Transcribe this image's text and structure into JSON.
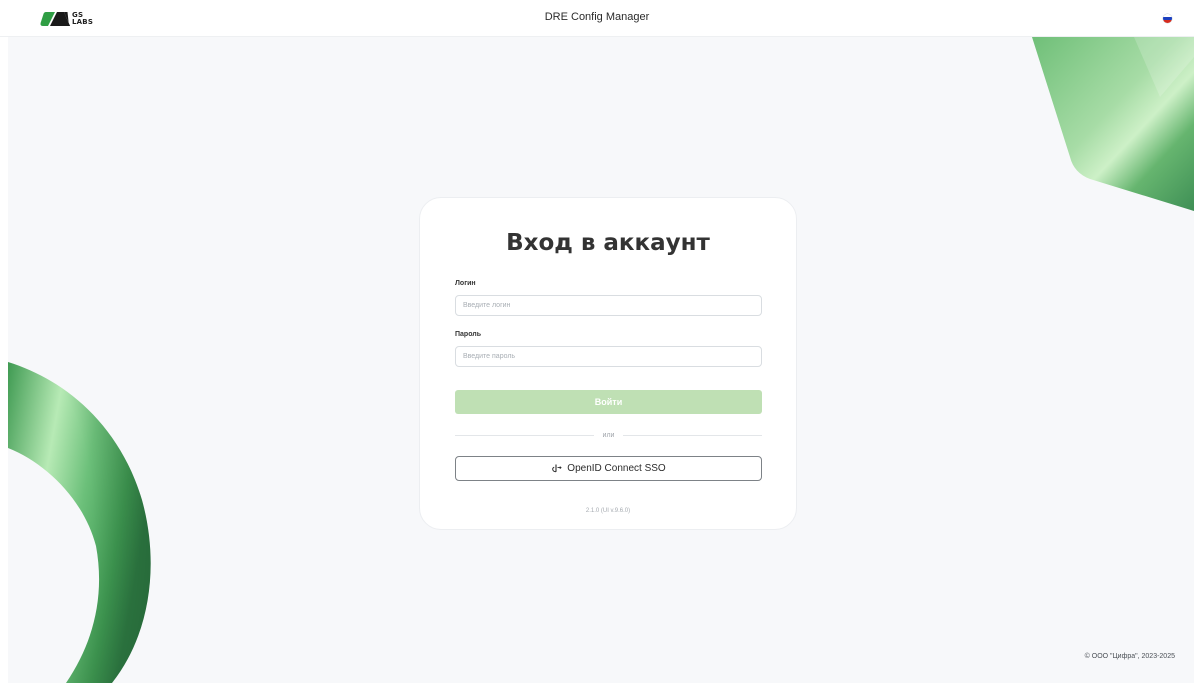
{
  "header": {
    "logo_top": "GS",
    "logo_bottom": "LABS",
    "title": "DRE Config Manager",
    "language_icon": "russian-flag-icon"
  },
  "login_form": {
    "title": "Вход в аккаунт",
    "login": {
      "label": "Логин",
      "value": "",
      "placeholder": "Введите логин"
    },
    "password": {
      "label": "Пароль",
      "value": "",
      "placeholder": "Введите пароль"
    },
    "submit_label": "Войти",
    "divider_text": "или",
    "sso_icon": "openid-icon",
    "sso_label": "OpenID Connect SSO",
    "version": "2.1.0 (UI v.9.6.0)"
  },
  "footer": {
    "copyright": "© ООО \"Цифра\", 2023-2025"
  },
  "colors": {
    "brand_green": "#2f9e44",
    "login_button_disabled": "#bfe0b4",
    "page_background": "#f7f8fa"
  }
}
